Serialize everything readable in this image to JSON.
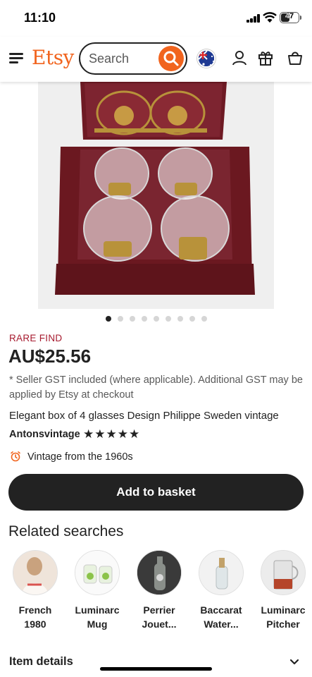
{
  "status_bar": {
    "time": "11:10",
    "battery": "47"
  },
  "header": {
    "logo": "Etsy",
    "search_placeholder": "Search",
    "icons": [
      "menu-icon",
      "search-icon",
      "flag-icon",
      "account-icon",
      "gift-icon",
      "basket-icon"
    ]
  },
  "gallery": {
    "image_count": 9,
    "active_index": 0
  },
  "listing": {
    "badge": "RARE FIND",
    "price": "AU$25.56",
    "gst_note": "* Seller GST included (where applicable). Additional GST may be applied by Etsy at checkout",
    "title": "Elegant box of 4 glasses Design Philippe Sweden vintage",
    "shop": "Antonsvintage",
    "stars": "★★★★★",
    "vintage": "Vintage from the 1960s",
    "add_to_basket": "Add to basket"
  },
  "related": {
    "title": "Related searches",
    "items": [
      {
        "label_1": "French",
        "label_2": "1980"
      },
      {
        "label_1": "Luminarc",
        "label_2": "Mug"
      },
      {
        "label_1": "Perrier",
        "label_2": "Jouet..."
      },
      {
        "label_1": "Baccarat",
        "label_2": "Water..."
      },
      {
        "label_1": "Luminarc",
        "label_2": "Pitcher"
      }
    ]
  },
  "details": {
    "title": "Item details"
  },
  "colors": {
    "accent": "#f1641e",
    "badge": "#a61a2e",
    "button": "#222222"
  }
}
